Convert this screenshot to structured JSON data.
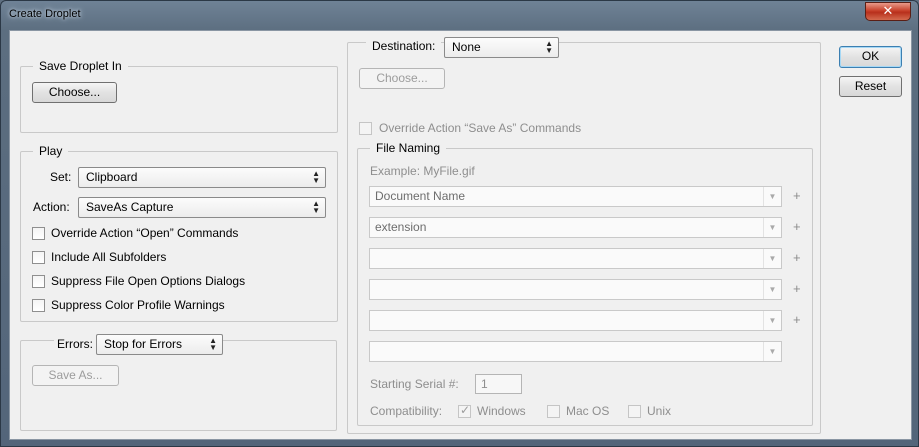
{
  "window": {
    "title": "Create Droplet",
    "close_glyph": "✕"
  },
  "buttons": {
    "ok": "OK",
    "reset": "Reset"
  },
  "save_droplet": {
    "legend": "Save Droplet In",
    "choose": "Choose..."
  },
  "play": {
    "legend": "Play",
    "set_label": "Set:",
    "set_value": "Clipboard",
    "action_label": "Action:",
    "action_value": "SaveAs Capture",
    "options": [
      {
        "label": "Override Action “Open” Commands",
        "checked": false
      },
      {
        "label": "Include All Subfolders",
        "checked": false
      },
      {
        "label": "Suppress File Open Options Dialogs",
        "checked": false
      },
      {
        "label": "Suppress Color Profile Warnings",
        "checked": false
      }
    ]
  },
  "errors": {
    "label": "Errors:",
    "value": "Stop for Errors",
    "save_as": "Save As..."
  },
  "destination": {
    "label": "Destination:",
    "value": "None",
    "choose": "Choose...",
    "override_label": "Override Action “Save As” Commands"
  },
  "file_naming": {
    "legend": "File Naming",
    "example": "Example: MyFile.gif",
    "fields": [
      "Document Name",
      "extension",
      "",
      "",
      "",
      ""
    ],
    "plus": "+",
    "serial_label": "Starting Serial #:",
    "serial_value": "1",
    "compat_label": "Compatibility:",
    "compat": [
      {
        "label": "Windows",
        "checked": true
      },
      {
        "label": "Mac OS",
        "checked": false
      },
      {
        "label": "Unix",
        "checked": false
      }
    ]
  },
  "icons": {
    "dropdown": "updown-arrows-icon",
    "combo": "chevron-down-icon",
    "check": "✓"
  },
  "colors": {
    "title_gradient": "#5c6e80",
    "close": "#c8412b",
    "panel": "#f0f0f0"
  }
}
